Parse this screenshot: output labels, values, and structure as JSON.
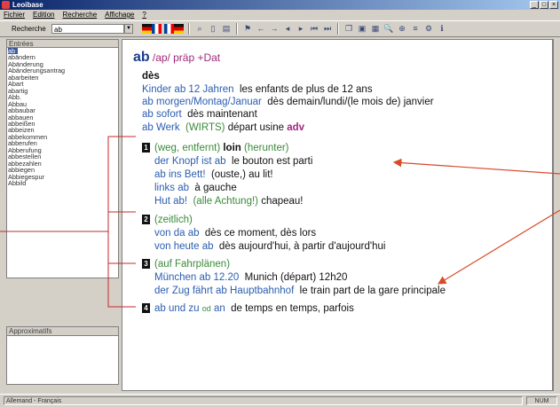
{
  "window": {
    "title": "Leoibase",
    "controls": [
      "_",
      "□",
      "×"
    ]
  },
  "menu": [
    "Fichier",
    "Edition",
    "Recherche",
    "Affichage",
    "?"
  ],
  "toolbar": {
    "search_label": "Recherche",
    "search_value": "ab"
  },
  "left_pane": {
    "header": "Entrées",
    "items": [
      "ab",
      "abändern",
      "Abänderung",
      "Abänderungsantrag",
      "abarbeiten",
      "Abart",
      "abartig",
      "Abb.",
      "Abbau",
      "abbaubar",
      "abbauen",
      "abbeißen",
      "abbeizen",
      "abbekommen",
      "abberufen",
      "Abberufung",
      "abbestellen",
      "abbezahlen",
      "abbiegen",
      "Abbiegespur",
      "Abbild"
    ],
    "selected": "ab",
    "header2": "Approximatifs"
  },
  "entry": {
    "headword": "ab",
    "phonetic": "/ap/",
    "pos": "präp +Dat",
    "translation": "dès",
    "examples": [
      {
        "de": "Kinder ab 12 Jahren",
        "fr": "les enfants de plus de 12 ans"
      },
      {
        "de": "ab morgen/Montag/Januar",
        "fr": "dès demain/lundi/(le mois de) janvier"
      },
      {
        "de": "ab sofort",
        "fr": "dès maintenant"
      }
    ],
    "werk": {
      "de": "ab Werk",
      "label": "(WIRTS)",
      "fr": "départ usine",
      "adv": "adv"
    },
    "senses": [
      {
        "n": "1",
        "label": "(weg, entfernt)",
        "main": "loin",
        "label2": "(herunter)",
        "examples": [
          {
            "de": "der Knopf ist ab",
            "fr": "le bouton est parti"
          },
          {
            "de": "ab ins Bett!",
            "fr": "(ouste,) au lit!"
          },
          {
            "de": "links ab",
            "fr": "à gauche"
          },
          {
            "de": "Hut ab!",
            "label": "(alle Achtung!)",
            "fr": "chapeau!"
          }
        ]
      },
      {
        "n": "2",
        "label": "(zeitlich)",
        "examples": [
          {
            "de": "von da ab",
            "fr": "dès ce moment, dès lors"
          },
          {
            "de": "von heute ab",
            "fr": "dès aujourd'hui, à partir d'aujourd'hui"
          }
        ]
      },
      {
        "n": "3",
        "label": "(auf Fahrplänen)",
        "examples": [
          {
            "de": "München ab 12.20",
            "fr": "Munich (départ) 12h20"
          },
          {
            "de": "der Zug fährt ab Hauptbahnhof",
            "fr": "le train part de la gare principale"
          }
        ]
      },
      {
        "n": "4",
        "de1": "ab und zu",
        "od": "od",
        "de2": "an",
        "fr": "de temps en temps, parfois"
      }
    ]
  },
  "status": {
    "language": "Allemand - Français",
    "mode": "NUM"
  },
  "colors": {
    "annotation": "#d84a2a",
    "brackets": "#c62828",
    "selection": "#3c5aa0"
  }
}
